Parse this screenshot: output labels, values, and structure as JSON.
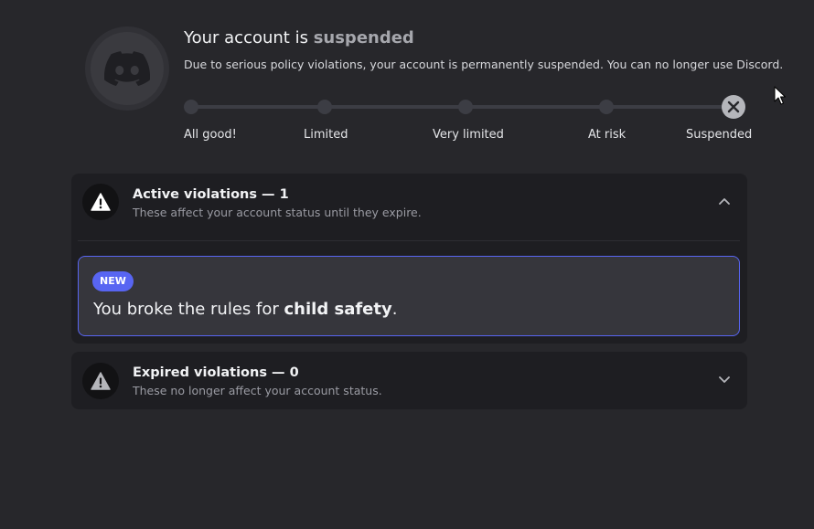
{
  "header": {
    "title_prefix": "Your account is ",
    "title_status": "suspended",
    "description": "Due to serious policy violations, your account is permanently suspended. You can no longer use Discord.",
    "avatar_icon": "discord-logo-icon"
  },
  "status_steps": [
    {
      "label": "All good!"
    },
    {
      "label": "Limited"
    },
    {
      "label": "Very limited"
    },
    {
      "label": "At risk"
    },
    {
      "label": "Suspended",
      "icon": "close-icon"
    }
  ],
  "active_violations": {
    "title": "Active violations — 1",
    "subtitle": "These affect your account status until they expire.",
    "icon": "warning-icon",
    "expanded": true,
    "items": [
      {
        "badge": "NEW",
        "text_prefix": "You broke the rules for ",
        "text_bold": "child safety",
        "text_suffix": "."
      }
    ]
  },
  "expired_violations": {
    "title": "Expired violations — 0",
    "subtitle": "These no longer affect your account status.",
    "icon": "warning-icon",
    "expanded": false
  },
  "colors": {
    "background": "#27272b",
    "card": "#1e1e22",
    "accent": "#5865f2",
    "violation_card": "#36363c"
  }
}
